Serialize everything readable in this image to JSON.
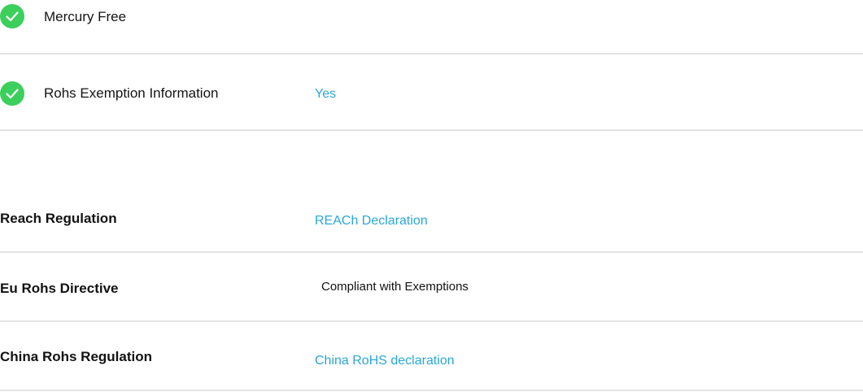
{
  "features": [
    {
      "label": "Mercury Free",
      "value": ""
    },
    {
      "label": "Rohs Exemption Information",
      "value": "Yes"
    }
  ],
  "regulations": [
    {
      "label": "Reach Regulation",
      "value": "REACh Declaration",
      "is_link": true
    },
    {
      "label": "Eu Rohs Directive",
      "value": "Compliant with Exemptions",
      "is_link": false
    },
    {
      "label": "China Rohs Regulation",
      "value": "China RoHS declaration",
      "is_link": true
    }
  ],
  "colors": {
    "check_green": "#3ccf5c",
    "link_blue": "#2aa7d8",
    "divider": "#e3e3e3"
  },
  "icons": {
    "status": "check-circle-icon"
  }
}
